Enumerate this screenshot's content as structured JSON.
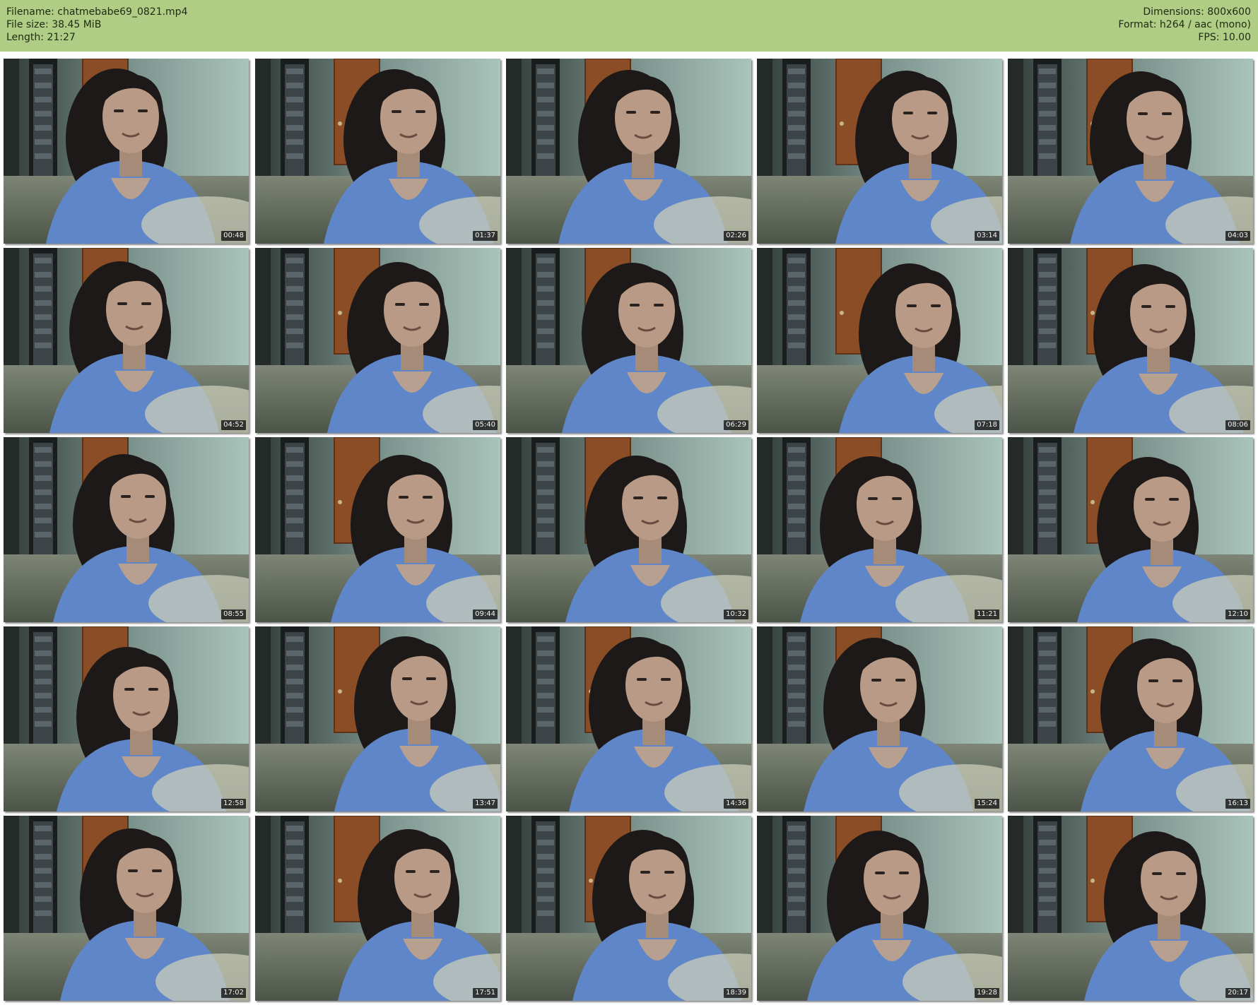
{
  "header": {
    "filename": "Filename: chatmebabe69_0821.mp4",
    "file_size": "File size: 38.45 MiB",
    "length": "Length: 21:27",
    "dimensions": "Dimensions: 800x600",
    "format": "Format: h264 / aac (mono)",
    "fps": "FPS: 10.00"
  },
  "colors": {
    "header_bg": "#b0cd85",
    "page_bg": "#ffffff"
  },
  "grid": {
    "columns": 5,
    "rows": 5
  },
  "thumbnails": [
    {
      "timestamp": "00:48"
    },
    {
      "timestamp": "01:37"
    },
    {
      "timestamp": "02:26"
    },
    {
      "timestamp": "03:14"
    },
    {
      "timestamp": "04:03"
    },
    {
      "timestamp": "04:52"
    },
    {
      "timestamp": "05:40"
    },
    {
      "timestamp": "06:29"
    },
    {
      "timestamp": "07:18"
    },
    {
      "timestamp": "08:06"
    },
    {
      "timestamp": "08:55"
    },
    {
      "timestamp": "09:44"
    },
    {
      "timestamp": "10:32"
    },
    {
      "timestamp": "11:21"
    },
    {
      "timestamp": "12:10"
    },
    {
      "timestamp": "12:58"
    },
    {
      "timestamp": "13:47"
    },
    {
      "timestamp": "14:36"
    },
    {
      "timestamp": "15:24"
    },
    {
      "timestamp": "16:13"
    },
    {
      "timestamp": "17:02"
    },
    {
      "timestamp": "17:51"
    },
    {
      "timestamp": "18:39"
    },
    {
      "timestamp": "19:28"
    },
    {
      "timestamp": "20:17"
    }
  ]
}
